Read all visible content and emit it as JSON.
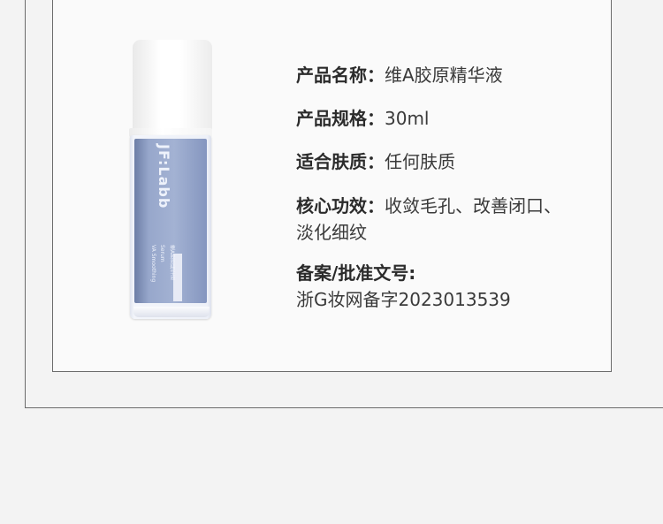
{
  "product_image": {
    "brand": "JF:Labb",
    "line1": "VA Smoothing",
    "line2": "Serum",
    "line3": "维A胶原精华液"
  },
  "info": {
    "name_label": "产品名称：",
    "name_value": "维A胶原精华液",
    "spec_label": "产品规格：",
    "spec_value": "30ml",
    "skin_label": "适合肤质：",
    "skin_value": "任何肤质",
    "effect_label": "核心功效：",
    "effect_value_line1": "收敛毛孔、改善闭口、",
    "effect_value_line2": "淡化细纹",
    "filing_label": "备案/批准文号:",
    "filing_value": "浙G妆网备字2023013539"
  }
}
